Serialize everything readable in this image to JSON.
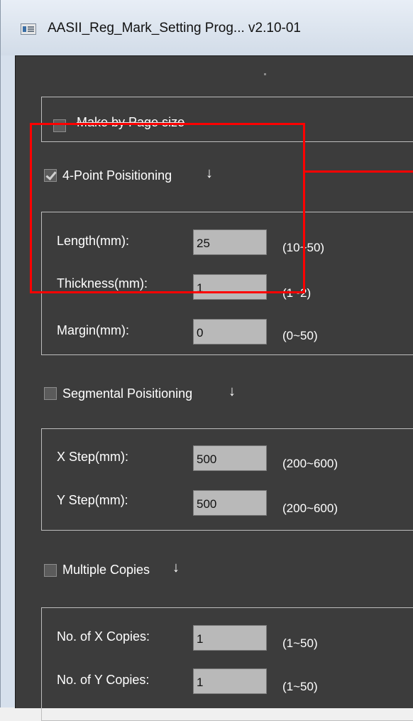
{
  "window": {
    "title": "AASII_Reg_Mark_Setting Prog... v2.10-01"
  },
  "make_by_page_size": {
    "label": "Make by Page size",
    "checked": false
  },
  "four_point": {
    "label": "4-Point Poisitioning",
    "arrow": "↓",
    "checked": true,
    "fields": [
      {
        "label": "Length(mm):",
        "value": "25",
        "range": "(10~50)"
      },
      {
        "label": "Thickness(mm):",
        "value": "1",
        "range": "(1~2)"
      },
      {
        "label": "Margin(mm):",
        "value": "0",
        "range": "(0~50)"
      }
    ]
  },
  "segmental": {
    "label": "Segmental Poisitioning",
    "arrow": "↓",
    "checked": false,
    "fields": [
      {
        "label": "X Step(mm):",
        "value": "500",
        "range": "(200~600)"
      },
      {
        "label": "Y Step(mm):",
        "value": "500",
        "range": "(200~600)"
      }
    ]
  },
  "multiple_copies": {
    "label": "Multiple Copies",
    "arrow": "↓",
    "checked": false,
    "fields": [
      {
        "label": "No. of X Copies:",
        "value": "1",
        "range": "(1~50)"
      },
      {
        "label": "No. of Y Copies:",
        "value": "1",
        "range": "(1~50)"
      }
    ]
  },
  "colors": {
    "client_bg": "#3c3c3c",
    "input_bg": "#b9b9b9",
    "highlight": "#ff0000"
  },
  "icons": {
    "app": "app-window-icon",
    "checkbox_checked": "checkmark-icon",
    "expand": "down-arrow-icon"
  }
}
